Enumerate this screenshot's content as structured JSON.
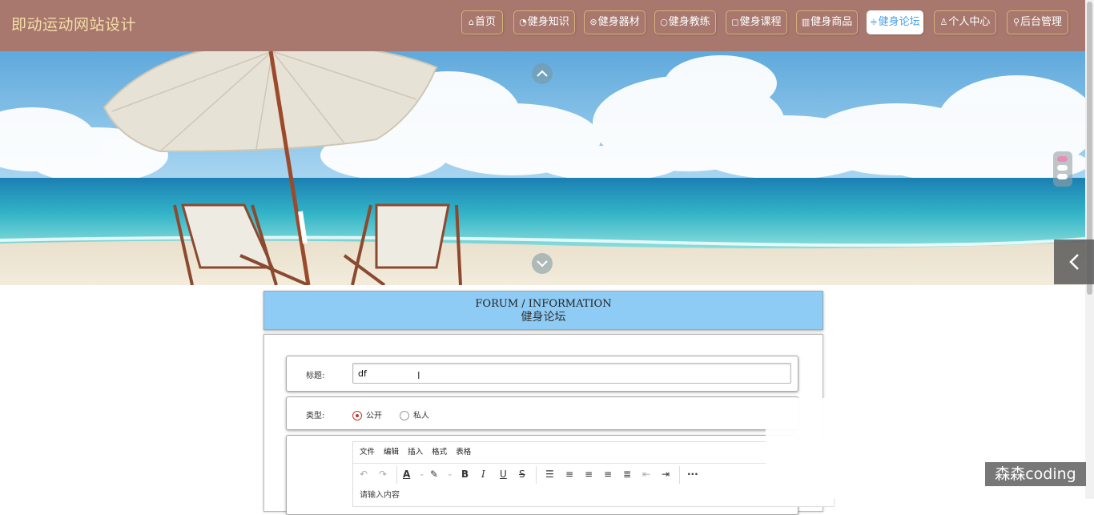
{
  "header": {
    "site_title": "即动运动网站设计",
    "nav": [
      {
        "icon": "home-icon",
        "glyph": "⌂",
        "label": "首页"
      },
      {
        "icon": "knowledge-icon",
        "glyph": "◔",
        "label": "健身知识"
      },
      {
        "icon": "equipment-icon",
        "glyph": "⊜",
        "label": "健身器材"
      },
      {
        "icon": "coach-icon",
        "glyph": "○",
        "label": "健身教练"
      },
      {
        "icon": "course-icon",
        "glyph": "◻",
        "label": "健身课程"
      },
      {
        "icon": "goods-icon",
        "glyph": "▥",
        "label": "健身商品"
      },
      {
        "icon": "forum-icon",
        "glyph": "≑",
        "label": "健身论坛"
      },
      {
        "icon": "user-icon",
        "glyph": "♙",
        "label": "个人中心"
      },
      {
        "icon": "admin-link-icon",
        "glyph": "⚲",
        "label": "后台管理"
      }
    ],
    "active_tab": "健身论坛",
    "active_color": "#4aa0e6",
    "bar_color": "#a8786e"
  },
  "banner": {
    "slide_count": 3,
    "active_slide": 1
  },
  "section": {
    "title_en": "FORUM / INFORMATION",
    "title_cn": "健身论坛"
  },
  "form": {
    "title_label": "标题:",
    "title_value": "df",
    "type_label": "类型:",
    "type_options": [
      "公开",
      "私人"
    ],
    "type_selected": "公开",
    "editor_menu": [
      "文件",
      "编辑",
      "插入",
      "格式",
      "表格"
    ],
    "editor_placeholder": "请输入内容"
  },
  "watermark": "森森coding"
}
